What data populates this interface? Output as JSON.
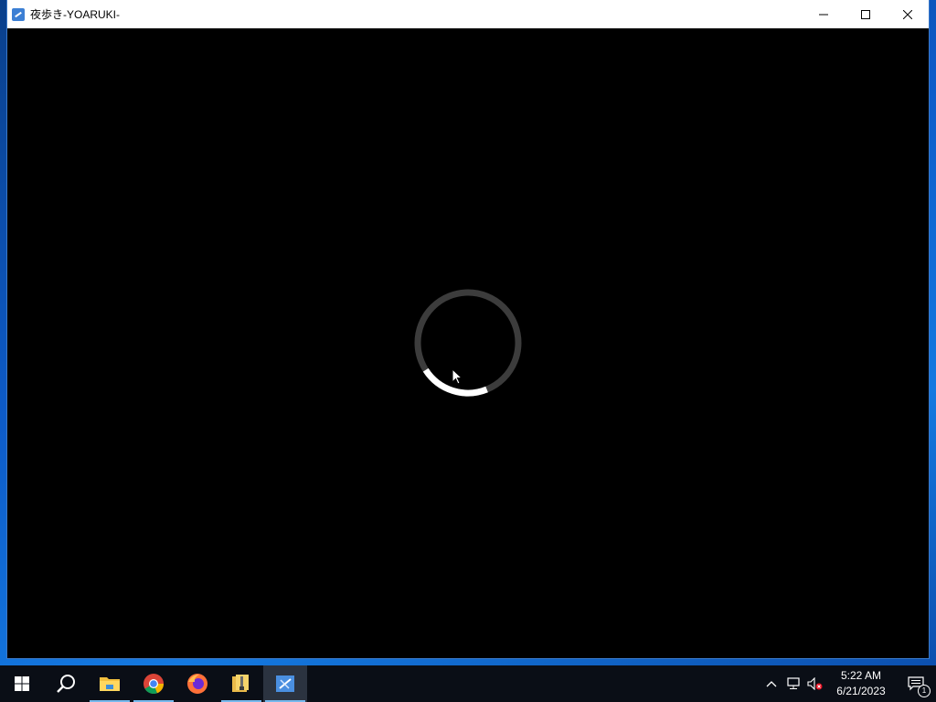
{
  "window": {
    "title": "夜歩き-YOARUKI-",
    "controls": {
      "minimize": "minimize-icon",
      "maximize": "maximize-icon",
      "close": "close-icon"
    }
  },
  "content": {
    "state": "loading",
    "spinner": {
      "track_color": "#3c3c3c",
      "arc_color": "#ffffff",
      "progress": 0.22
    }
  },
  "taskbar": {
    "items": [
      {
        "name": "start",
        "icon": "windows-logo-icon"
      },
      {
        "name": "search",
        "icon": "search-icon"
      },
      {
        "name": "file-explorer",
        "icon": "folder-icon",
        "running": true
      },
      {
        "name": "chrome",
        "icon": "chrome-icon",
        "running": true
      },
      {
        "name": "firefox",
        "icon": "firefox-icon"
      },
      {
        "name": "archive",
        "icon": "archive-icon",
        "running": true
      },
      {
        "name": "yoaruki",
        "icon": "app-icon",
        "running": true,
        "active": true
      }
    ],
    "tray": {
      "icons": [
        "chevron-up-icon",
        "network-icon",
        "volume-muted-icon"
      ],
      "time": "5:22 AM",
      "date": "6/21/2023",
      "notifications_count": "1"
    }
  },
  "colors": {
    "taskbar": "#0a0e16",
    "desktop": "#0d5bc8",
    "accent": "#76b9ed"
  }
}
